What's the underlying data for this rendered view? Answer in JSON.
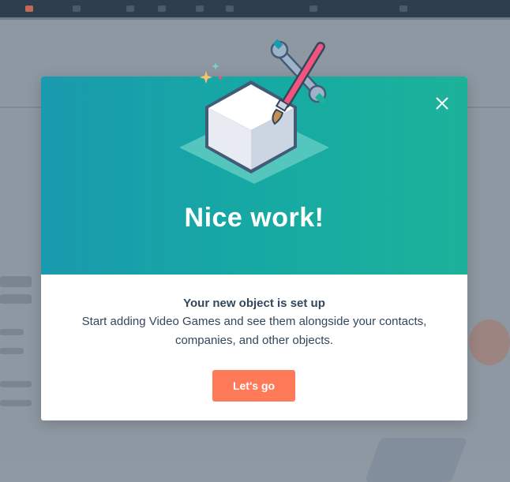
{
  "modal": {
    "heading": "Nice work!",
    "title": "Your new object is set up",
    "description": "Start adding Video Games and see them alongside your contacts, companies, and other objects.",
    "cta_label": "Let's go",
    "close_icon": "close-icon",
    "illustration_icons": [
      "cube-icon",
      "paintbrush-icon",
      "wrench-icon",
      "sparkle-icon"
    ]
  },
  "colors": {
    "header_gradient_start": "#1a9aae",
    "header_gradient_end": "#1cb29a",
    "cta": "#ff7a59",
    "text": "#33475b",
    "overlay": "#8f99a3"
  }
}
